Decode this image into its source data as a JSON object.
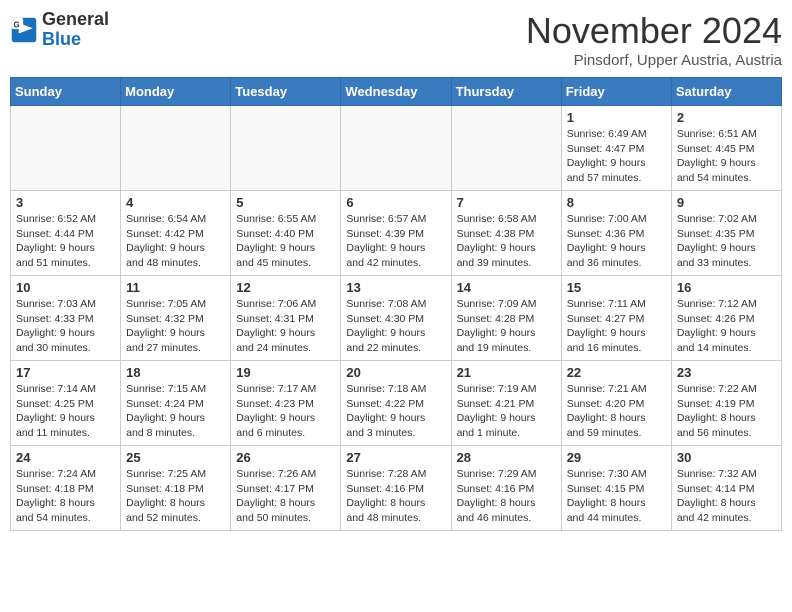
{
  "header": {
    "logo_general": "General",
    "logo_blue": "Blue",
    "month_title": "November 2024",
    "location": "Pinsdorf, Upper Austria, Austria"
  },
  "weekdays": [
    "Sunday",
    "Monday",
    "Tuesday",
    "Wednesday",
    "Thursday",
    "Friday",
    "Saturday"
  ],
  "weeks": [
    [
      {
        "day": "",
        "info": ""
      },
      {
        "day": "",
        "info": ""
      },
      {
        "day": "",
        "info": ""
      },
      {
        "day": "",
        "info": ""
      },
      {
        "day": "",
        "info": ""
      },
      {
        "day": "1",
        "info": "Sunrise: 6:49 AM\nSunset: 4:47 PM\nDaylight: 9 hours\nand 57 minutes."
      },
      {
        "day": "2",
        "info": "Sunrise: 6:51 AM\nSunset: 4:45 PM\nDaylight: 9 hours\nand 54 minutes."
      }
    ],
    [
      {
        "day": "3",
        "info": "Sunrise: 6:52 AM\nSunset: 4:44 PM\nDaylight: 9 hours\nand 51 minutes."
      },
      {
        "day": "4",
        "info": "Sunrise: 6:54 AM\nSunset: 4:42 PM\nDaylight: 9 hours\nand 48 minutes."
      },
      {
        "day": "5",
        "info": "Sunrise: 6:55 AM\nSunset: 4:40 PM\nDaylight: 9 hours\nand 45 minutes."
      },
      {
        "day": "6",
        "info": "Sunrise: 6:57 AM\nSunset: 4:39 PM\nDaylight: 9 hours\nand 42 minutes."
      },
      {
        "day": "7",
        "info": "Sunrise: 6:58 AM\nSunset: 4:38 PM\nDaylight: 9 hours\nand 39 minutes."
      },
      {
        "day": "8",
        "info": "Sunrise: 7:00 AM\nSunset: 4:36 PM\nDaylight: 9 hours\nand 36 minutes."
      },
      {
        "day": "9",
        "info": "Sunrise: 7:02 AM\nSunset: 4:35 PM\nDaylight: 9 hours\nand 33 minutes."
      }
    ],
    [
      {
        "day": "10",
        "info": "Sunrise: 7:03 AM\nSunset: 4:33 PM\nDaylight: 9 hours\nand 30 minutes."
      },
      {
        "day": "11",
        "info": "Sunrise: 7:05 AM\nSunset: 4:32 PM\nDaylight: 9 hours\nand 27 minutes."
      },
      {
        "day": "12",
        "info": "Sunrise: 7:06 AM\nSunset: 4:31 PM\nDaylight: 9 hours\nand 24 minutes."
      },
      {
        "day": "13",
        "info": "Sunrise: 7:08 AM\nSunset: 4:30 PM\nDaylight: 9 hours\nand 22 minutes."
      },
      {
        "day": "14",
        "info": "Sunrise: 7:09 AM\nSunset: 4:28 PM\nDaylight: 9 hours\nand 19 minutes."
      },
      {
        "day": "15",
        "info": "Sunrise: 7:11 AM\nSunset: 4:27 PM\nDaylight: 9 hours\nand 16 minutes."
      },
      {
        "day": "16",
        "info": "Sunrise: 7:12 AM\nSunset: 4:26 PM\nDaylight: 9 hours\nand 14 minutes."
      }
    ],
    [
      {
        "day": "17",
        "info": "Sunrise: 7:14 AM\nSunset: 4:25 PM\nDaylight: 9 hours\nand 11 minutes."
      },
      {
        "day": "18",
        "info": "Sunrise: 7:15 AM\nSunset: 4:24 PM\nDaylight: 9 hours\nand 8 minutes."
      },
      {
        "day": "19",
        "info": "Sunrise: 7:17 AM\nSunset: 4:23 PM\nDaylight: 9 hours\nand 6 minutes."
      },
      {
        "day": "20",
        "info": "Sunrise: 7:18 AM\nSunset: 4:22 PM\nDaylight: 9 hours\nand 3 minutes."
      },
      {
        "day": "21",
        "info": "Sunrise: 7:19 AM\nSunset: 4:21 PM\nDaylight: 9 hours\nand 1 minute."
      },
      {
        "day": "22",
        "info": "Sunrise: 7:21 AM\nSunset: 4:20 PM\nDaylight: 8 hours\nand 59 minutes."
      },
      {
        "day": "23",
        "info": "Sunrise: 7:22 AM\nSunset: 4:19 PM\nDaylight: 8 hours\nand 56 minutes."
      }
    ],
    [
      {
        "day": "24",
        "info": "Sunrise: 7:24 AM\nSunset: 4:18 PM\nDaylight: 8 hours\nand 54 minutes."
      },
      {
        "day": "25",
        "info": "Sunrise: 7:25 AM\nSunset: 4:18 PM\nDaylight: 8 hours\nand 52 minutes."
      },
      {
        "day": "26",
        "info": "Sunrise: 7:26 AM\nSunset: 4:17 PM\nDaylight: 8 hours\nand 50 minutes."
      },
      {
        "day": "27",
        "info": "Sunrise: 7:28 AM\nSunset: 4:16 PM\nDaylight: 8 hours\nand 48 minutes."
      },
      {
        "day": "28",
        "info": "Sunrise: 7:29 AM\nSunset: 4:16 PM\nDaylight: 8 hours\nand 46 minutes."
      },
      {
        "day": "29",
        "info": "Sunrise: 7:30 AM\nSunset: 4:15 PM\nDaylight: 8 hours\nand 44 minutes."
      },
      {
        "day": "30",
        "info": "Sunrise: 7:32 AM\nSunset: 4:14 PM\nDaylight: 8 hours\nand 42 minutes."
      }
    ]
  ]
}
